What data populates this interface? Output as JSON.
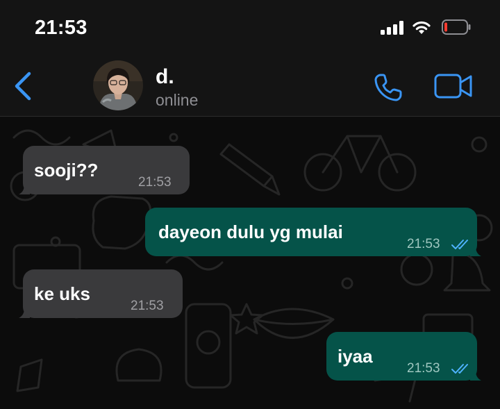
{
  "status_bar": {
    "time": "21:53"
  },
  "header": {
    "contact_name": "d.",
    "contact_status": "online",
    "icons": {
      "back": "chevron-left-icon",
      "call": "phone-icon",
      "video": "video-camera-icon"
    },
    "accent_color": "#3a95f4"
  },
  "messages": [
    {
      "direction": "incoming",
      "text": "sooji??",
      "time": "21:53"
    },
    {
      "direction": "outgoing",
      "text": "dayeon dulu yg mulai",
      "time": "21:53",
      "status": "read"
    },
    {
      "direction": "incoming",
      "text": "ke uks",
      "time": "21:53"
    },
    {
      "direction": "outgoing",
      "text": "iyaa",
      "time": "21:53",
      "status": "read"
    }
  ],
  "colors": {
    "incoming_bubble": "#3a3a3c",
    "outgoing_bubble": "#055349",
    "read_ticks": "#4fb3ff",
    "battery_low": "#ff3b30"
  }
}
